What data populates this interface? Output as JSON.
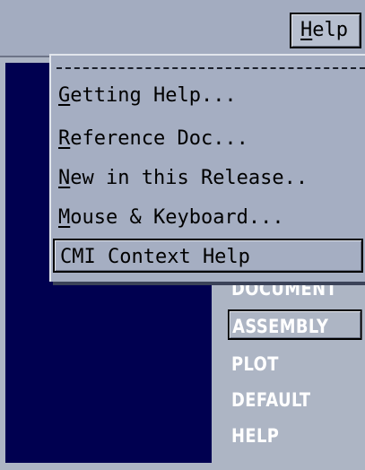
{
  "menubar": {
    "help_label_mnemonic": "H",
    "help_label_rest": "elp"
  },
  "help_menu": {
    "items": [
      {
        "mnemonic": "G",
        "rest": "etting Help..."
      },
      {
        "mnemonic": "R",
        "rest": "eference Doc..."
      },
      {
        "mnemonic": "N",
        "rest": "ew in this Release.."
      },
      {
        "mnemonic": "M",
        "rest": "ouse & Keyboard..."
      },
      {
        "label": "CMI Context Help"
      }
    ]
  },
  "side_panel": {
    "items": [
      "DOCUMENT",
      "ASSEMBLY",
      "PLOT",
      "DEFAULT",
      "HELP"
    ],
    "selected": "ASSEMBLY"
  },
  "colors": {
    "work_area": "#000050",
    "panel_bg": "#adb5c4",
    "menu_bg": "#a5aec2"
  }
}
